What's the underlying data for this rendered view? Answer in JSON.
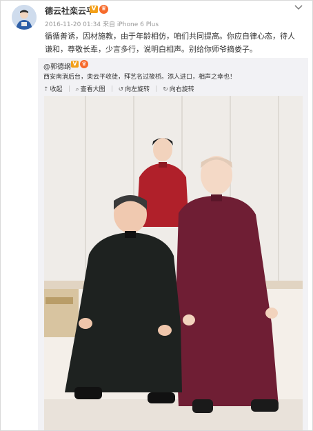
{
  "post": {
    "username": "德云社栾云平",
    "v_badge": "V",
    "crown_badge": "♛",
    "timestamp": "2016-11-20 01:34",
    "source_prefix": "来自",
    "source": "iPhone 6 Plus",
    "text": "循循善诱，因材施教，由于年龄相仿，咱们共同提高。你应自律心态，待人谦和，尊敬长辈，少言多行，说明白相声。别给你师爷摘娄子。"
  },
  "repost": {
    "author": "@郭德纲",
    "v_badge": "V",
    "crown_badge": "♛",
    "text": "西安南淌后台，栾云平收徒，拜艺名过筱桥。添人进口，相声之幸也！",
    "actions": {
      "collapse": "收起",
      "view_large": "查看大图",
      "rotate_left": "向左旋转",
      "rotate_right": "向右旋转"
    },
    "icons": {
      "collapse": "collapse-icon",
      "view_large": "magnify-icon",
      "rotate_left": "rotate-left-icon",
      "rotate_right": "rotate-right-icon"
    }
  },
  "colors": {
    "badge_v": "#f3a019",
    "badge_crown": "#f66a2b",
    "repost_bg": "#f2f2f5"
  }
}
